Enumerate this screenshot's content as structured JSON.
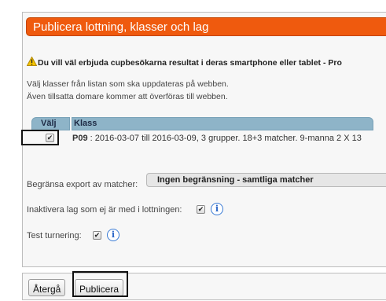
{
  "dialog": {
    "title": "Publicera lottning, klasser och lag"
  },
  "warning": {
    "icon": "warning-icon",
    "text": "Du vill väl erbjuda cupbesökarna resultat i deras smartphone eller tablet - Pro"
  },
  "info": {
    "line1": "Välj klasser från listan som ska uppdateras på webben.",
    "line2": "Även tillsatta domare kommer att överföras till webben."
  },
  "grid": {
    "col_valj": "Välj",
    "col_klass": "Klass",
    "rows": [
      {
        "checked": true,
        "code": "P09",
        "details": " : 2016-03-07 till 2016-03-09, 3 grupper. 18+3 matcher.   9-manna 2 X 13"
      }
    ]
  },
  "form": {
    "export_label": "Begränsa export av matcher:",
    "export_value": "Ingen begränsning - samtliga matcher",
    "inactivate_label": "Inaktivera lag som ej är med i lottningen:",
    "inactivate_checked": true,
    "test_label": "Test turnering:",
    "test_checked": true
  },
  "buttons": {
    "back": "Återgå",
    "publish": "Publicera"
  },
  "colors": {
    "title_bg": "#ef5a0e",
    "grid_header_bg": "#8eb4c8",
    "info_icon": "#2a66c7"
  }
}
